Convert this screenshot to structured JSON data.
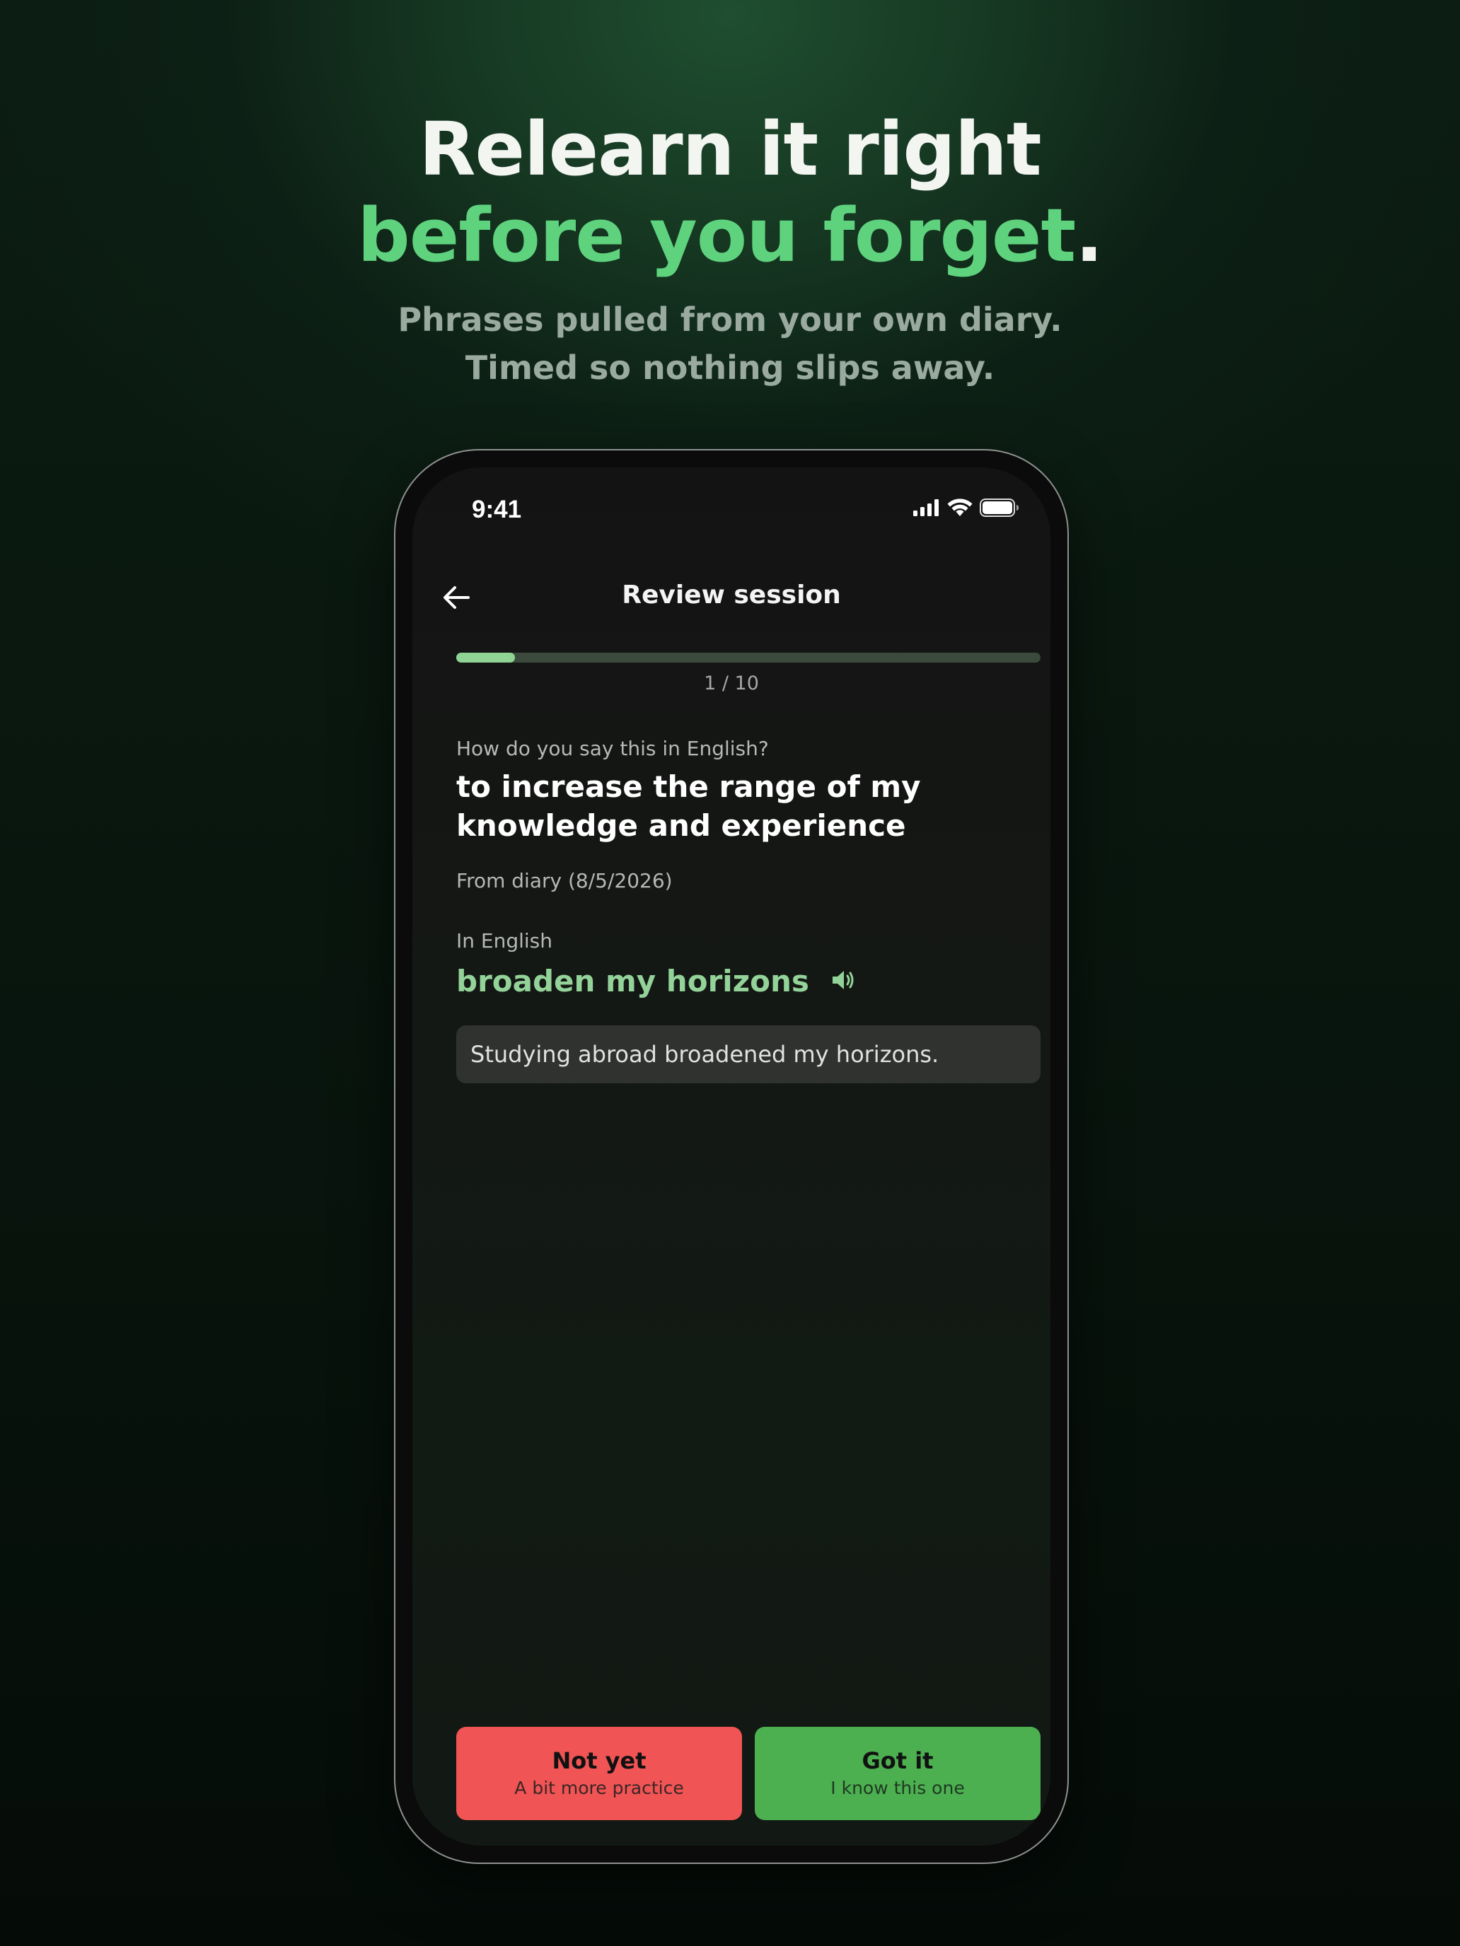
{
  "hero": {
    "title_line1": "Relearn it right",
    "title_line2": "before you forget",
    "title_period": ".",
    "subtitle_line1": "Phrases pulled from your own diary.",
    "subtitle_line2": "Timed so nothing slips away."
  },
  "status_bar": {
    "time": "9:41",
    "icons": [
      "cellular-signal-icon",
      "wifi-icon",
      "battery-icon"
    ]
  },
  "nav": {
    "back_icon": "arrow-left-icon",
    "title": "Review session"
  },
  "progress": {
    "current": 1,
    "total": 10,
    "label": "1 / 10",
    "fraction": 0.1
  },
  "card": {
    "prompt": "How do you say this in English?",
    "question": "to increase the range of my knowledge and experience",
    "source": "From diary (8/5/2026)",
    "answer_label": "In English",
    "answer": "broaden my horizons",
    "speaker_icon": "speaker-icon",
    "example": "Studying abroad broadened my horizons."
  },
  "actions": {
    "not_yet": {
      "label": "Not yet",
      "sublabel": "A bit more practice"
    },
    "got_it": {
      "label": "Got it",
      "sublabel": "I know this one"
    }
  },
  "colors": {
    "accent_green": "#5fd27e",
    "answer_green": "#93d399",
    "progress_fill": "#8fd494",
    "not_yet_red": "#f05454",
    "got_it_green": "#4caf50"
  }
}
